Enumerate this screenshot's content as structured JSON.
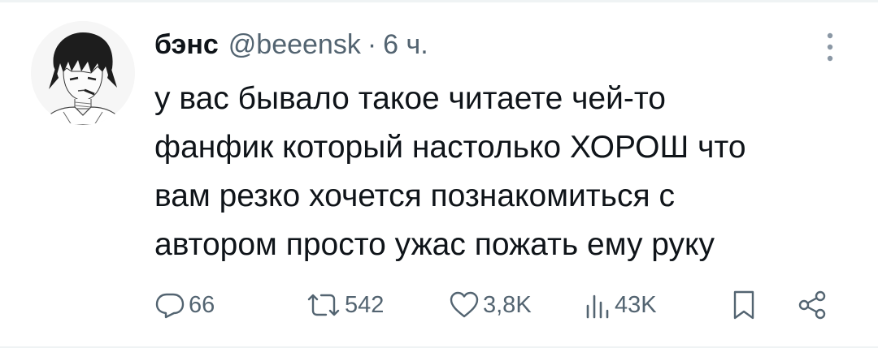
{
  "tweet": {
    "author_name": "бэнс",
    "handle": "@beeensk",
    "separator": "·",
    "time": "6 ч.",
    "text_lines": [
      "у вас бывало такое читаете чей-то",
      "фанфик который настолько ХОРОШ что",
      "вам резко хочется познакомиться с",
      "автором просто ужас пожать ему руку"
    ]
  },
  "actions": {
    "replies": "66",
    "retweets": "542",
    "likes": "3,8K",
    "views": "43K"
  },
  "icons": {
    "more": "more-vertical-icon",
    "reply": "reply-icon",
    "retweet": "retweet-icon",
    "like": "heart-icon",
    "views": "views-icon",
    "bookmark": "bookmark-icon",
    "share": "share-icon"
  },
  "colors": {
    "text": "#0f1419",
    "muted": "#536471",
    "divider": "#eff3f4"
  }
}
